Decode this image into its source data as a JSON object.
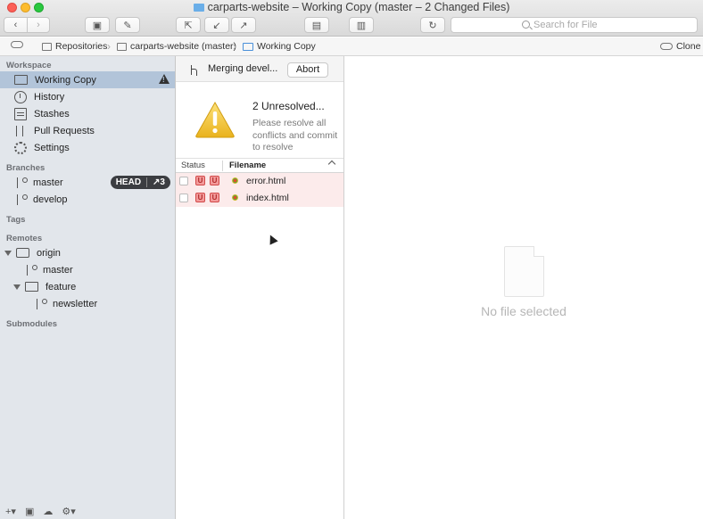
{
  "window": {
    "title": "carparts-website – Working Copy (master – 2 Changed Files)"
  },
  "toolbar": {
    "search_placeholder": "Search for File"
  },
  "breadcrumb": {
    "items": [
      "Repositories",
      "carparts-website (master)",
      "Working Copy"
    ],
    "clone_label": "Clone"
  },
  "sidebar": {
    "workspace_header": "Workspace",
    "workspace_items": [
      {
        "label": "Working Copy",
        "icon": "folder-icon",
        "selected": true
      },
      {
        "label": "History",
        "icon": "clock-icon"
      },
      {
        "label": "Stashes",
        "icon": "stash-icon"
      },
      {
        "label": "Pull Requests",
        "icon": "pull-request-icon"
      },
      {
        "label": "Settings",
        "icon": "gear-icon"
      }
    ],
    "branches_header": "Branches",
    "branches": [
      {
        "label": "master",
        "head_badge": "HEAD",
        "ahead_badge": "↗3"
      },
      {
        "label": "develop"
      }
    ],
    "tags_header": "Tags",
    "remotes_header": "Remotes",
    "remotes": {
      "origin": "origin",
      "origin_master": "master",
      "feature": "feature",
      "newsletter": "newsletter"
    },
    "submodules_header": "Submodules"
  },
  "merge": {
    "status_text": "Merging devel...",
    "abort_label": "Abort",
    "conflict_title": "2 Unresolved...",
    "conflict_desc": "Please resolve all conflicts and commit to resolve"
  },
  "file_list": {
    "columns": [
      "Status",
      "Filename"
    ],
    "rows": [
      {
        "status_a": "U",
        "status_b": "U",
        "filename": "error.html"
      },
      {
        "status_a": "U",
        "status_b": "U",
        "filename": "index.html"
      }
    ]
  },
  "detail": {
    "empty_text": "No file selected"
  },
  "colors": {
    "sidebar_bg": "#e2e6eb",
    "selection": "#b2c4d9",
    "conflict_row": "#fcebeb",
    "warning": "#f2c233"
  }
}
